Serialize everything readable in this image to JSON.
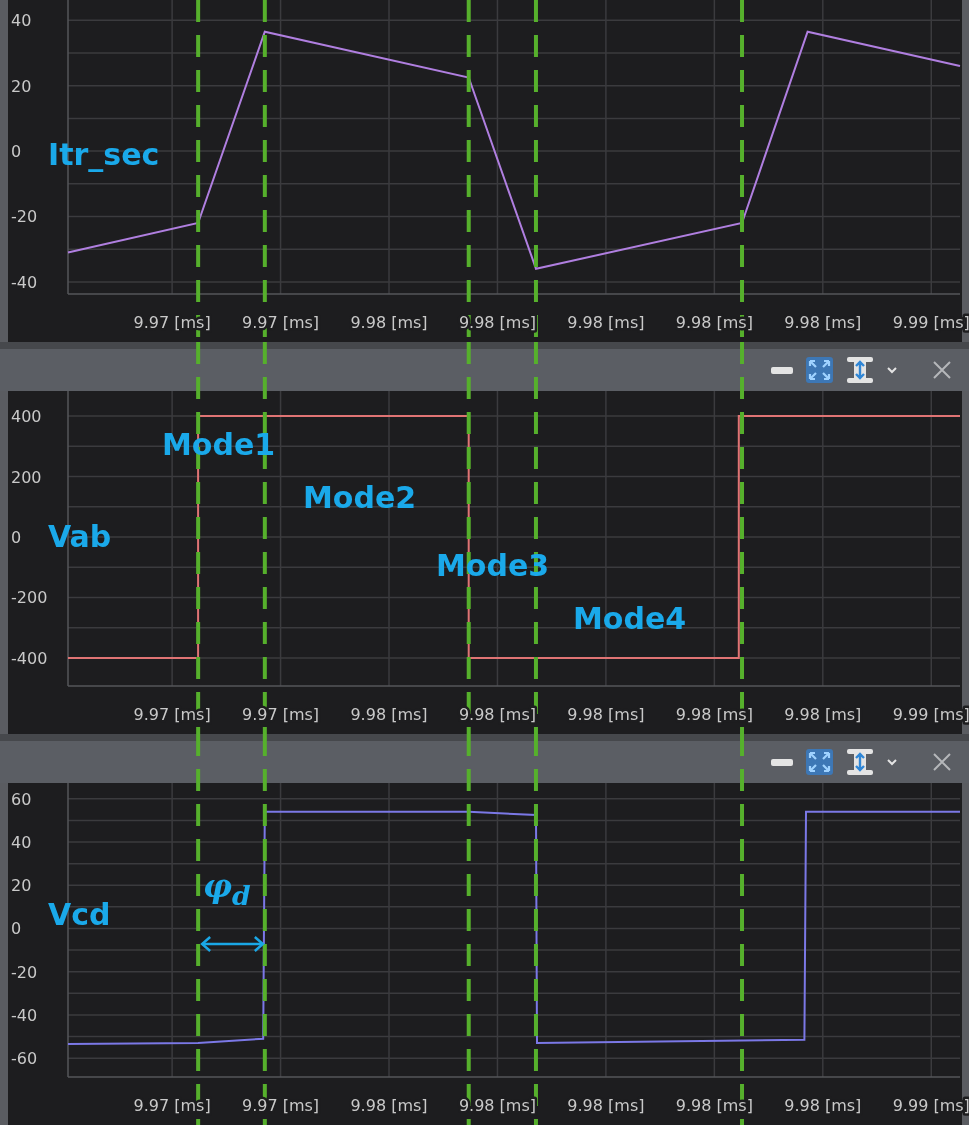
{
  "panels": [
    {
      "has_toolbar": false,
      "phase_arrow": false,
      "chart_data": {
        "type": "line",
        "grid": true,
        "x": [
          9.97008,
          9.97248,
          9.97371,
          9.97747,
          9.97871,
          9.98251,
          9.98372,
          9.98653
        ],
        "series": [
          {
            "color": "#b07fe0",
            "values": [
              -31,
              -22,
              36.5,
              22.5,
              -36,
              -22,
              36.5,
              26
            ]
          }
        ],
        "xlim": [
          9.97008,
          9.98653
        ],
        "ylim": [
          -43.7,
          46.2
        ],
        "xticks": [
          {
            "value": 9.972,
            "label": "9.97 [ms]"
          },
          {
            "value": 9.974,
            "label": "9.97 [ms]"
          },
          {
            "value": 9.976,
            "label": "9.98 [ms]"
          },
          {
            "value": 9.978,
            "label": "9.98 [ms]"
          },
          {
            "value": 9.98,
            "label": "9.98 [ms]"
          },
          {
            "value": 9.982,
            "label": "9.98 [ms]"
          },
          {
            "value": 9.984,
            "label": "9.98 [ms]"
          },
          {
            "value": 9.986,
            "label": "9.99 [ms]"
          }
        ],
        "yticks": [
          -40,
          -20,
          0,
          20,
          40
        ],
        "ref_lines": [
          {
            "axis": "x",
            "value": 9.97248
          },
          {
            "axis": "x",
            "value": 9.97371
          },
          {
            "axis": "x",
            "value": 9.97747
          },
          {
            "axis": "x",
            "value": 9.97871
          },
          {
            "axis": "x",
            "value": 9.98251
          }
        ],
        "annotations": [
          "Itr_sec"
        ]
      }
    },
    {
      "has_toolbar": true,
      "phase_arrow": false,
      "chart_data": {
        "type": "line",
        "grid": true,
        "x": [
          9.97008,
          9.97248,
          9.97248,
          9.97747,
          9.97747,
          9.98245,
          9.98245,
          9.98653
        ],
        "series": [
          {
            "color": "#e07474",
            "values": [
              -400,
              -400,
              400,
              400,
              -400,
              -400,
              400,
              400
            ]
          }
        ],
        "xlim": [
          9.97008,
          9.98653
        ],
        "ylim": [
          -493,
          483
        ],
        "xticks": [
          {
            "value": 9.972,
            "label": "9.97 [ms]"
          },
          {
            "value": 9.974,
            "label": "9.97 [ms]"
          },
          {
            "value": 9.976,
            "label": "9.98 [ms]"
          },
          {
            "value": 9.978,
            "label": "9.98 [ms]"
          },
          {
            "value": 9.98,
            "label": "9.98 [ms]"
          },
          {
            "value": 9.982,
            "label": "9.98 [ms]"
          },
          {
            "value": 9.984,
            "label": "9.98 [ms]"
          },
          {
            "value": 9.986,
            "label": "9.99 [ms]"
          }
        ],
        "yticks": [
          -400,
          -200,
          0,
          200,
          400
        ],
        "ref_lines": [
          {
            "axis": "x",
            "value": 9.97248
          },
          {
            "axis": "x",
            "value": 9.97371
          },
          {
            "axis": "x",
            "value": 9.97747
          },
          {
            "axis": "x",
            "value": 9.97871
          },
          {
            "axis": "x",
            "value": 9.98251
          }
        ],
        "annotations": [
          "Mode1",
          "Mode2",
          "Vab",
          "Mode3",
          "Mode4"
        ]
      }
    },
    {
      "has_toolbar": true,
      "phase_arrow": true,
      "chart_data": {
        "type": "line",
        "grid": true,
        "x": [
          9.97008,
          9.97248,
          9.97368,
          9.97371,
          9.97747,
          9.97871,
          9.97873,
          9.98366,
          9.98369,
          9.98653
        ],
        "series": [
          {
            "color": "#7b78e6",
            "values": [
              -53.5,
              -53,
              -51,
              54,
              54,
              52.5,
              -53,
              -51.5,
              54,
              54
            ]
          }
        ],
        "xlim": [
          9.97008,
          9.98653
        ],
        "ylim": [
          -68.7,
          67.3
        ],
        "xticks": [
          {
            "value": 9.972,
            "label": "9.97 [ms]"
          },
          {
            "value": 9.974,
            "label": "9.97 [ms]"
          },
          {
            "value": 9.976,
            "label": "9.98 [ms]"
          },
          {
            "value": 9.978,
            "label": "9.98 [ms]"
          },
          {
            "value": 9.98,
            "label": "9.98 [ms]"
          },
          {
            "value": 9.982,
            "label": "9.98 [ms]"
          },
          {
            "value": 9.984,
            "label": "9.98 [ms]"
          },
          {
            "value": 9.986,
            "label": "9.99 [ms]"
          }
        ],
        "yticks": [
          -60,
          -40,
          -20,
          0,
          20,
          40,
          60
        ],
        "ref_lines": [
          {
            "axis": "x",
            "value": 9.97248
          },
          {
            "axis": "x",
            "value": 9.97371
          },
          {
            "axis": "x",
            "value": 9.97747
          },
          {
            "axis": "x",
            "value": 9.97871
          },
          {
            "axis": "x",
            "value": 9.98251
          }
        ],
        "annotations": [
          "Vcd",
          "φ$_{d}$"
        ]
      }
    }
  ]
}
